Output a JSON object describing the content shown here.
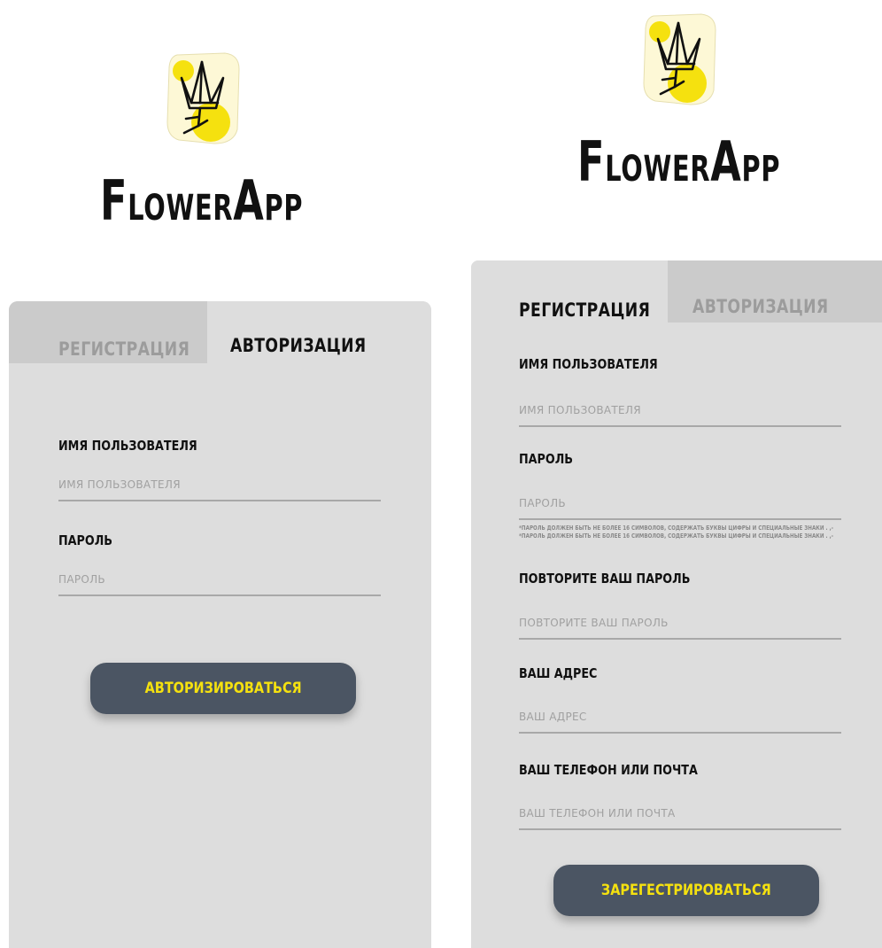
{
  "brand": {
    "name_parts": [
      "F",
      "LOWER",
      "A",
      "PP"
    ],
    "colors": {
      "accent_yellow": "#f5e10f",
      "logo_bg": "#fdf8d6",
      "panel_bg": "#dddddd",
      "inactive_tab_bg": "#cbcbcb",
      "button_bg": "#4b5563",
      "underline": "#a8a8a8"
    }
  },
  "login": {
    "tabs": {
      "register": "РЕГИСТРАЦИЯ",
      "login": "АВТОРИЗАЦИЯ"
    },
    "active_tab": "login",
    "fields": [
      {
        "label": "ИМЯ ПОЛЬЗОВАТЕЛЯ",
        "placeholder": "ИМЯ ПОЛЬЗОВАТЕЛЯ",
        "value": ""
      },
      {
        "label": "ПАРОЛЬ",
        "placeholder": "ПАРОЛЬ",
        "value": ""
      }
    ],
    "submit_label": "АВТОРИЗИРОВАТЬСЯ"
  },
  "register": {
    "tabs": {
      "register": "РЕГИСТРАЦИЯ",
      "login": "АВТОРИЗАЦИЯ"
    },
    "active_tab": "register",
    "fields": [
      {
        "label": "ИМЯ ПОЛЬЗОВАТЕЛЯ",
        "placeholder": "ИМЯ ПОЛЬЗОВАТЕЛЯ",
        "value": ""
      },
      {
        "label": "ПАРОЛЬ",
        "placeholder": "ПАРОЛЬ",
        "value": ""
      },
      {
        "label": "ПОВТОРИТЕ ВАШ ПАРОЛЬ",
        "placeholder": "ПОВТОРИТЕ ВАШ ПАРОЛЬ",
        "value": ""
      },
      {
        "label": "ВАШ АДРЕС",
        "placeholder": "ВАШ АДРЕС",
        "value": ""
      },
      {
        "label": "ВАШ ТЕЛЕФОН ИЛИ ПОЧТА",
        "placeholder": "ВАШ ТЕЛЕФОН ИЛИ ПОЧТА",
        "value": ""
      }
    ],
    "password_hint": "*ПАРОЛЬ ДОЛЖЕН БЫТЬ НЕ БОЛЕЕ 16 СИМВОЛОВ, СОДЕРЖАТЬ БУКВЫ ЦИФРЫ И СПЕЦИАЛЬНЫЕ ЗНАКИ . ,-*ПАРОЛЬ ДОЛЖЕН БЫТЬ НЕ БОЛЕЕ 16 СИМВОЛОВ, СОДЕРЖАТЬ БУКВЫ ЦИФРЫ И СПЕЦИАЛЬНЫЕ ЗНАКИ . ,-",
    "submit_label": "ЗАРЕГЕСТРИРОВАТЬСЯ"
  }
}
